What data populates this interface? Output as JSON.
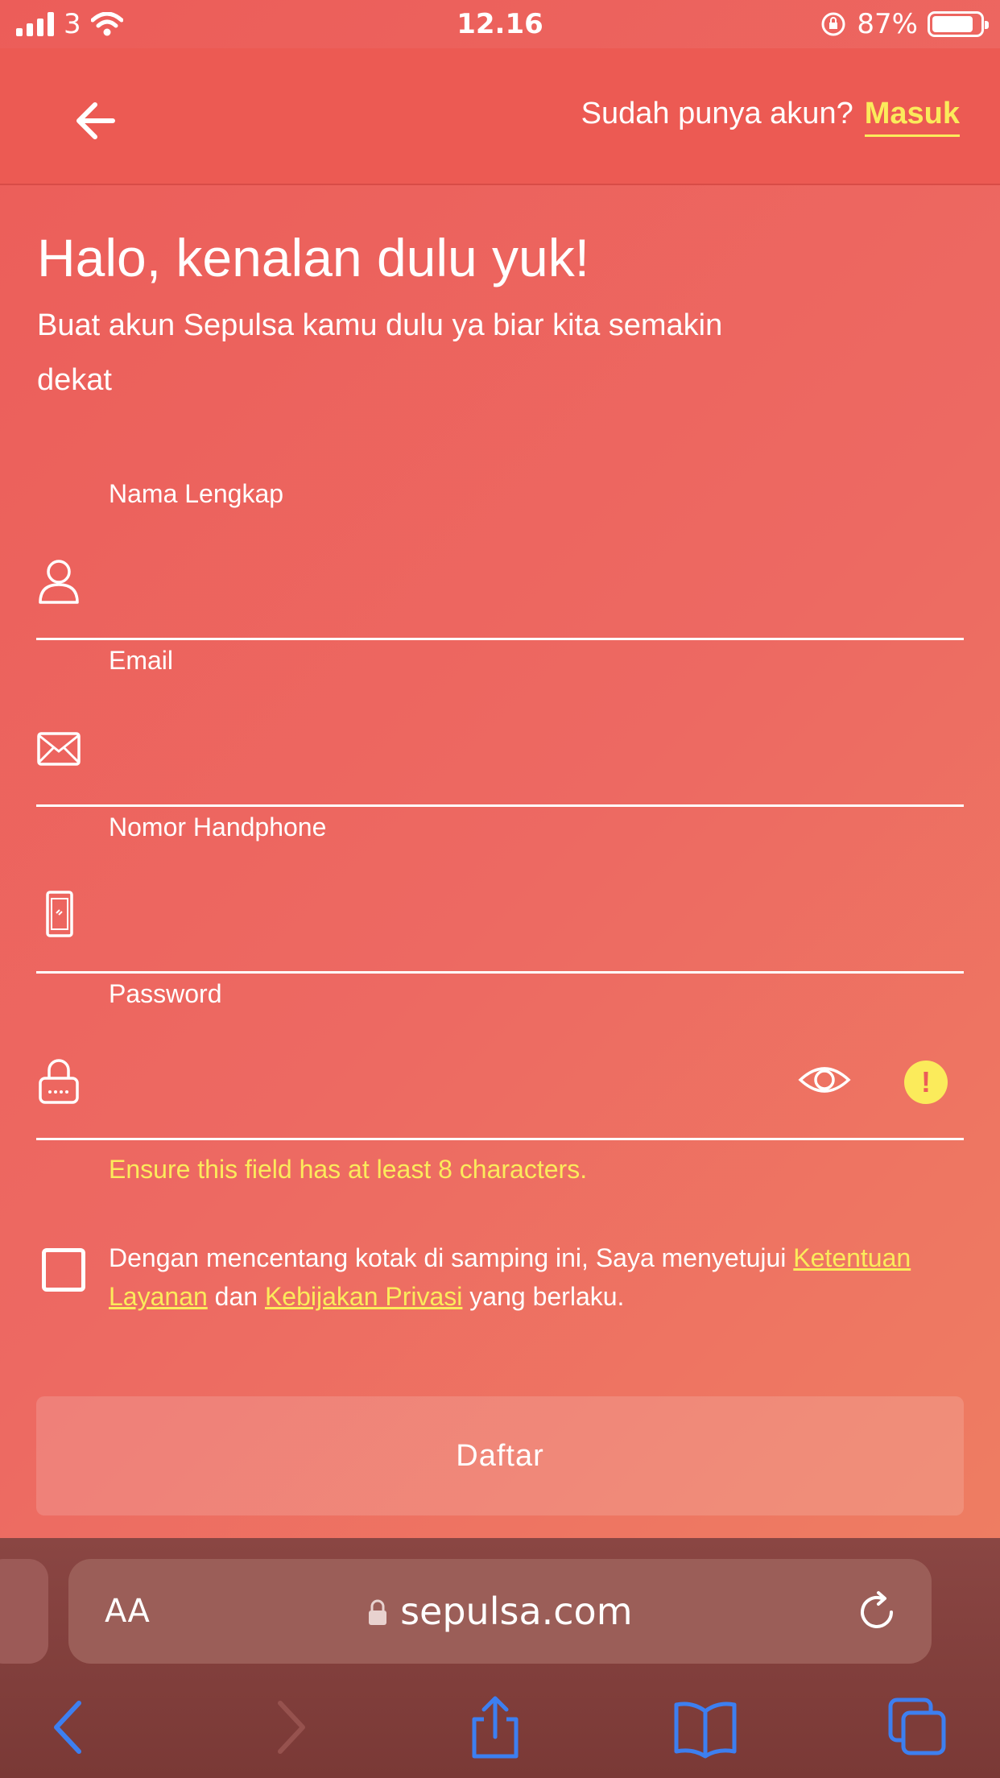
{
  "status_bar": {
    "carrier": "3",
    "time": "12.16",
    "battery": "87%",
    "battery_level": 0.87
  },
  "header": {
    "prompt": "Sudah punya akun?",
    "login_link": "Masuk"
  },
  "intro": {
    "title": "Halo, kenalan dulu yuk!",
    "subtitle": "Buat akun Sepulsa kamu dulu ya biar kita semakin dekat"
  },
  "form": {
    "name_label": "Nama Lengkap",
    "email_label": "Email",
    "phone_label": "Nomor Handphone",
    "password_label": "Password",
    "password_error": "Ensure this field has at least 8 characters.",
    "terms": {
      "prefix": "Dengan mencentang kotak di samping ini, Saya menyetujui ",
      "tos_link": "Ketentuan Layanan",
      "middle": " dan ",
      "privacy_link": "Kebijakan Privasi",
      "suffix": " yang berlaku.",
      "checked": false
    },
    "submit_label": "Daftar"
  },
  "browser": {
    "text_size": "AA",
    "url": "sepulsa.com"
  },
  "colors": {
    "accent": "#fbeb5b",
    "background": "#ec5d59",
    "safari_blue": "#3d7ff0"
  }
}
